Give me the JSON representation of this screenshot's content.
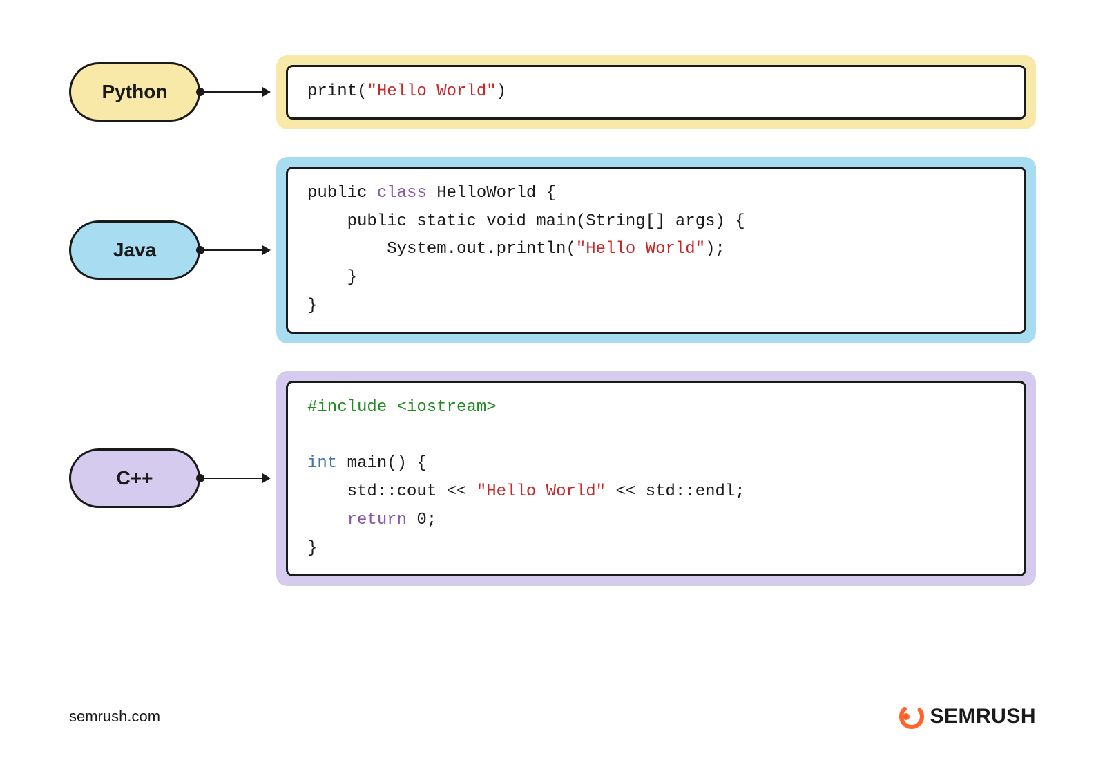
{
  "languages": [
    {
      "name": "Python",
      "color": "yellow",
      "code": [
        [
          {
            "t": "print(",
            "c": ""
          },
          {
            "t": "\"Hello World\"",
            "c": "tok-string"
          },
          {
            "t": ")",
            "c": ""
          }
        ]
      ]
    },
    {
      "name": "Java",
      "color": "blue",
      "code": [
        [
          {
            "t": "public ",
            "c": ""
          },
          {
            "t": "class",
            "c": "tok-keyword"
          },
          {
            "t": " HelloWorld {",
            "c": ""
          }
        ],
        [
          {
            "t": "    public static void main(String[] args) {",
            "c": ""
          }
        ],
        [
          {
            "t": "        System.out.println(",
            "c": ""
          },
          {
            "t": "\"Hello World\"",
            "c": "tok-string"
          },
          {
            "t": ");",
            "c": ""
          }
        ],
        [
          {
            "t": "    }",
            "c": ""
          }
        ],
        [
          {
            "t": "}",
            "c": ""
          }
        ]
      ]
    },
    {
      "name": "C++",
      "color": "purple",
      "code": [
        [
          {
            "t": "#include <iostream>",
            "c": "tok-include"
          }
        ],
        [
          {
            "t": "",
            "c": ""
          }
        ],
        [
          {
            "t": "int",
            "c": "tok-type"
          },
          {
            "t": " main() {",
            "c": ""
          }
        ],
        [
          {
            "t": "    std::cout << ",
            "c": ""
          },
          {
            "t": "\"Hello World\"",
            "c": "tok-string"
          },
          {
            "t": " << std::endl;",
            "c": ""
          }
        ],
        [
          {
            "t": "    ",
            "c": ""
          },
          {
            "t": "return",
            "c": "tok-keyword"
          },
          {
            "t": " 0;",
            "c": ""
          }
        ],
        [
          {
            "t": "}",
            "c": ""
          }
        ]
      ]
    }
  ],
  "footer": {
    "url": "semrush.com",
    "brand": "SEMRUSH"
  }
}
